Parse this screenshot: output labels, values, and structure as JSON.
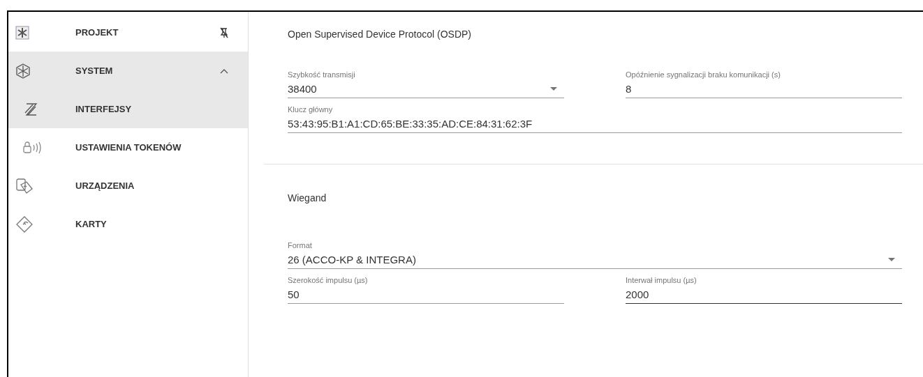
{
  "sidebar": {
    "header": {
      "label": "PROJEKT"
    },
    "items": [
      {
        "label": "SYSTEM",
        "kind": "system",
        "selected": true,
        "expanded": true,
        "children": [
          {
            "label": "INTERFEJSY",
            "kind": "interfaces",
            "selected": true
          },
          {
            "label": "USTAWIENIA TOKENÓW",
            "kind": "tokens",
            "selected": false
          }
        ]
      },
      {
        "label": "URZĄDZENIA",
        "kind": "devices",
        "selected": false
      },
      {
        "label": "KARTY",
        "kind": "cards",
        "selected": false
      }
    ]
  },
  "sections": [
    {
      "title": "Open Supervised Device Protocol (OSDP)",
      "rows": [
        [
          {
            "kind": "select",
            "label": "Szybkość transmisji",
            "value": "38400",
            "focused": false
          },
          {
            "kind": "text",
            "label": "Opóźnienie sygnalizacji braku komunikacji (s)",
            "value": "8",
            "focused": false
          }
        ],
        [
          {
            "kind": "text",
            "label": "Klucz główny",
            "value": "53:43:95:B1:A1:CD:65:BE:33:35:AD:CE:84:31:62:3F",
            "focused": false
          }
        ]
      ]
    },
    {
      "title": "Wiegand",
      "rows": [
        [
          {
            "kind": "select",
            "label": "Format",
            "value": "26 (ACCO-KP & INTEGRA)",
            "focused": false
          }
        ],
        [
          {
            "kind": "text",
            "label": "Szerokość impulsu (µs)",
            "value": "50",
            "focused": false
          },
          {
            "kind": "text",
            "label": "Interwał impulsu (µs)",
            "value": "2000",
            "focused": true
          }
        ]
      ]
    }
  ]
}
